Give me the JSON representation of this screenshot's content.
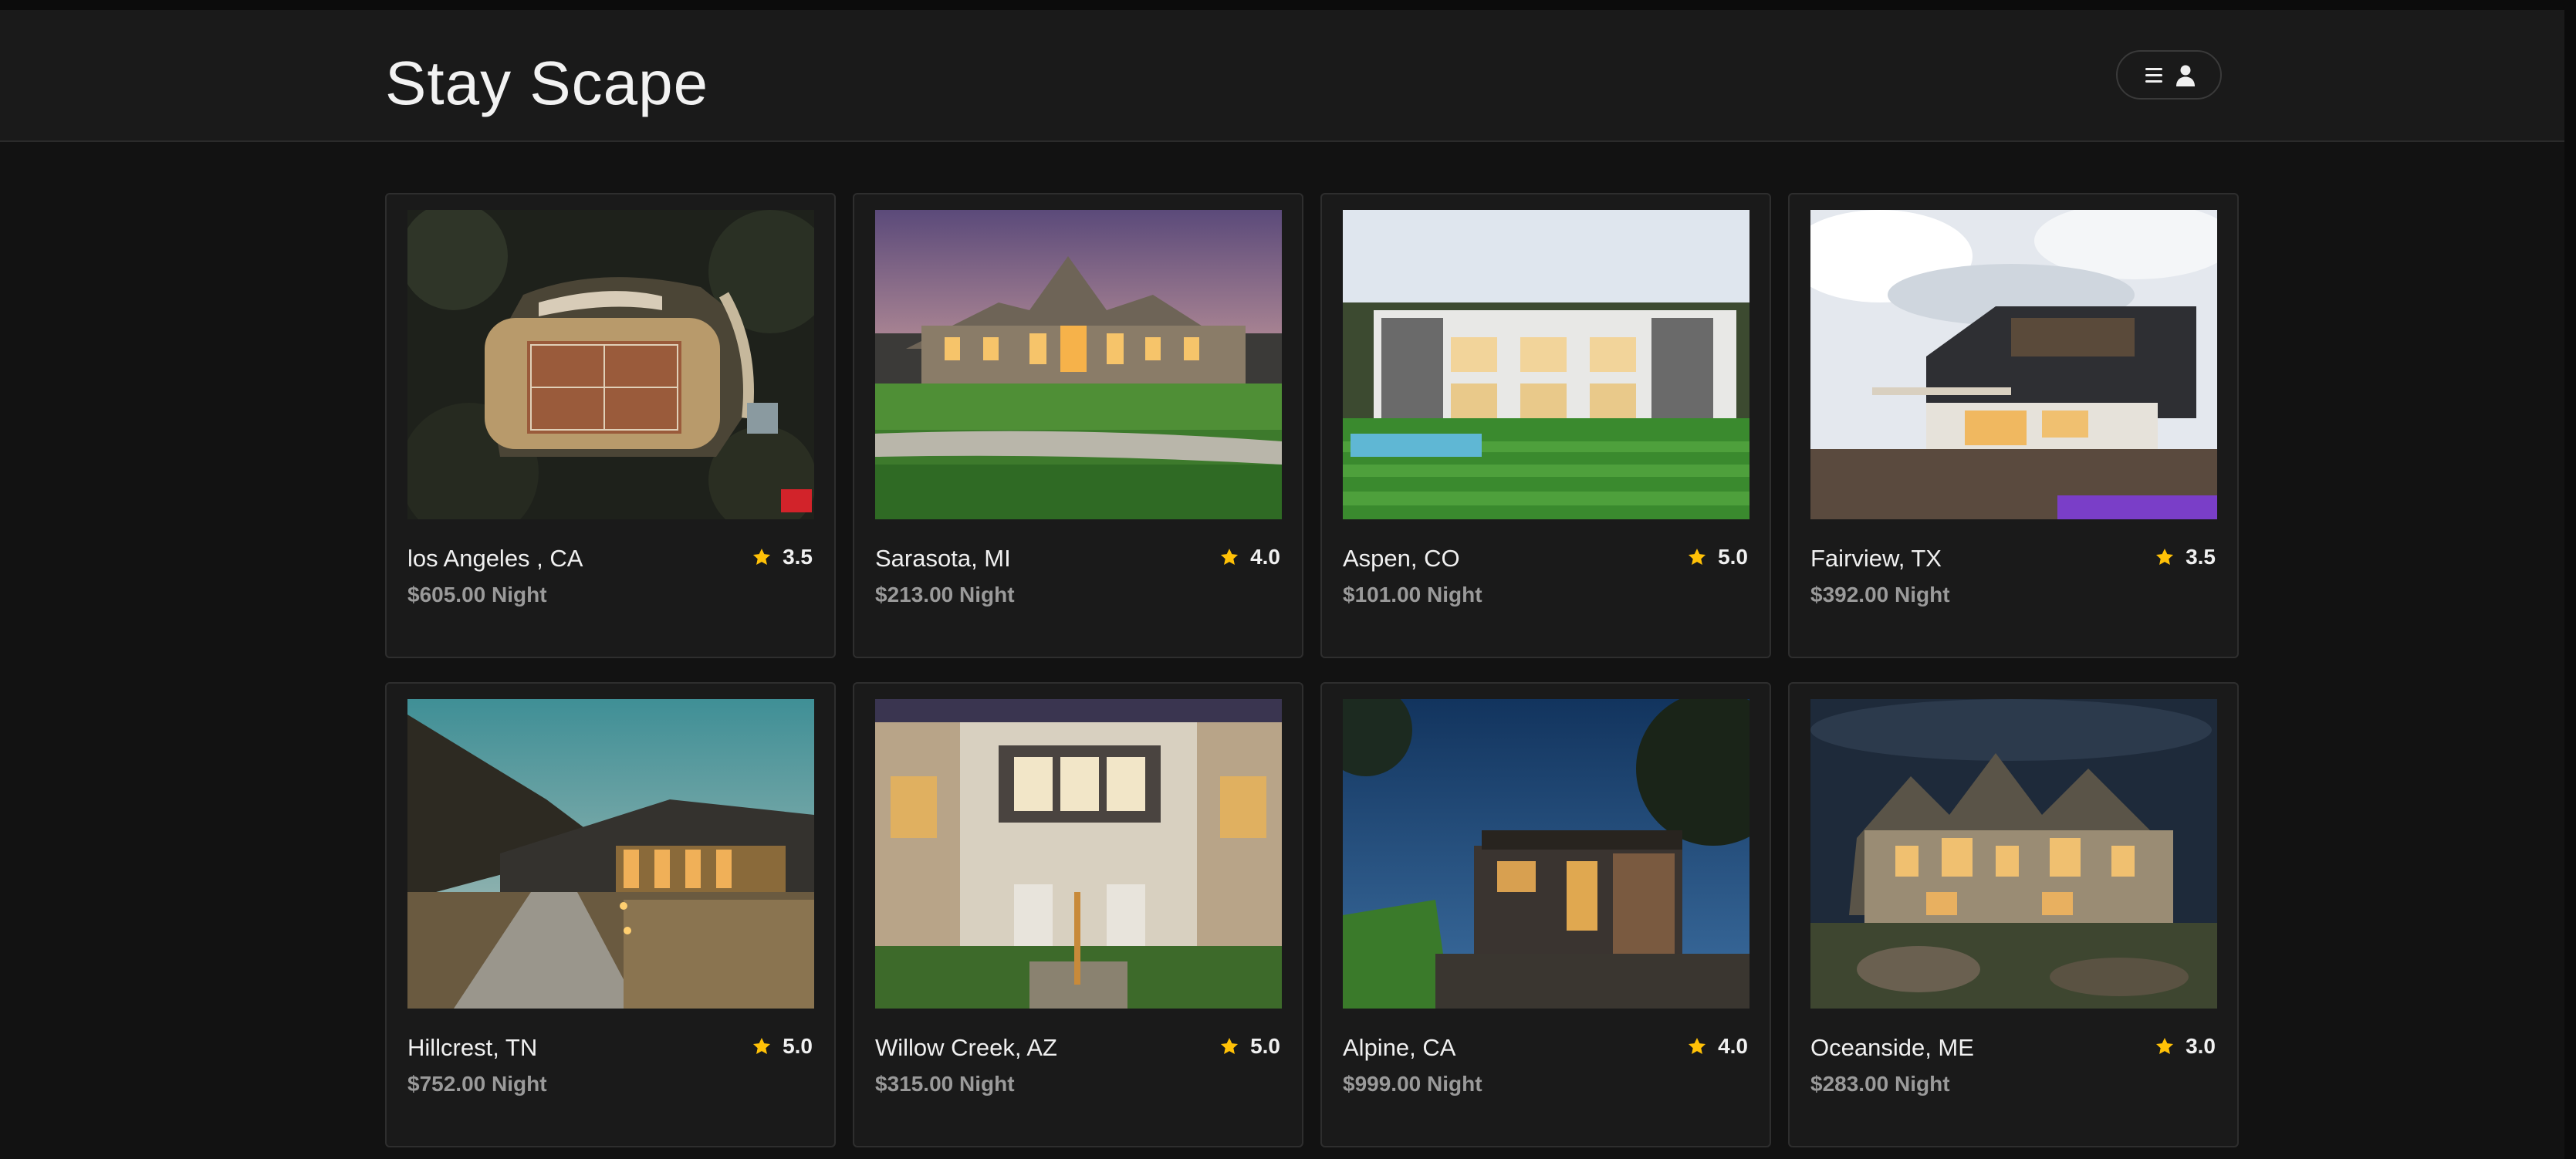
{
  "app": {
    "brand": "Stay Scape"
  },
  "header": {
    "menu_icon": "hamburger-icon",
    "user_icon": "user-icon"
  },
  "colors": {
    "star": "#FFC107",
    "background": "#121212",
    "card": "#1a1a1a"
  },
  "listings": [
    {
      "location": "los Angeles , CA",
      "rating": "3.5",
      "price": "$605.00 Night",
      "photo": "aerial-tennis-court"
    },
    {
      "location": "Sarasota, MI",
      "rating": "4.0",
      "price": "$213.00 Night",
      "photo": "mansion-dusk"
    },
    {
      "location": "Aspen, CO",
      "rating": "5.0",
      "price": "$101.00 Night",
      "photo": "modern-house-pool"
    },
    {
      "location": "Fairview, TX",
      "rating": "3.5",
      "price": "$392.00 Night",
      "photo": "modern-two-story"
    },
    {
      "location": "Hillcrest, TN",
      "rating": "5.0",
      "price": "$752.00 Night",
      "photo": "lodge-path"
    },
    {
      "location": "Willow Creek, AZ",
      "rating": "5.0",
      "price": "$315.00 Night",
      "photo": "townhouse-lit"
    },
    {
      "location": "Alpine, CA",
      "rating": "4.0",
      "price": "$999.00 Night",
      "photo": "hillside-house"
    },
    {
      "location": "Oceanside, ME",
      "rating": "3.0",
      "price": "$283.00 Night",
      "photo": "stone-castle-house"
    }
  ]
}
